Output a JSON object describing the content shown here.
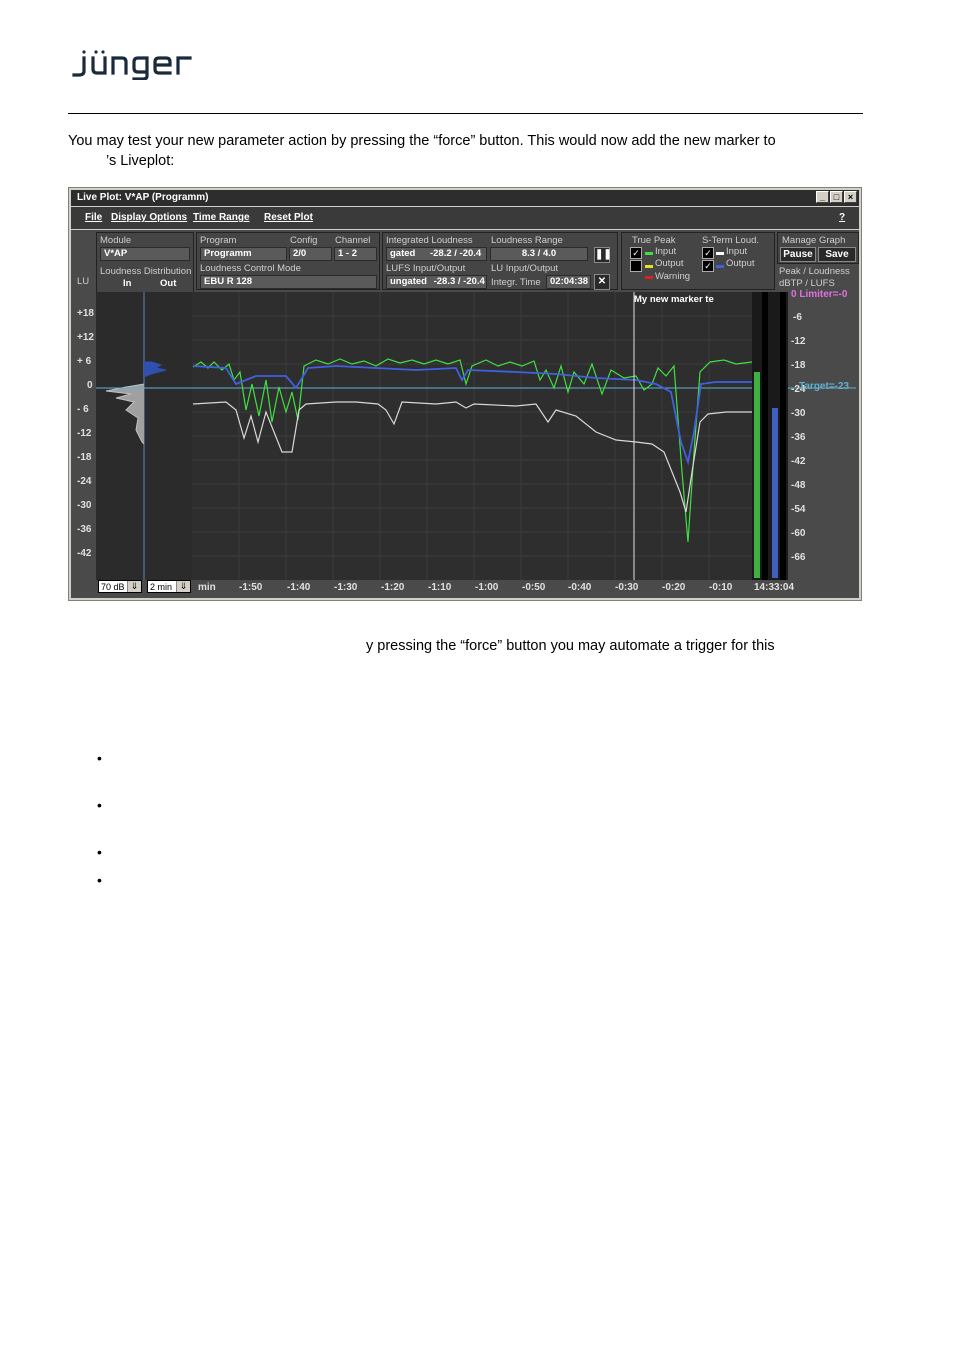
{
  "header": {
    "logo_text": "jünger"
  },
  "intro_text": "You may test your new parameter action by pressing the “force” button. This would now add the new marker to",
  "intro_text_2": "’s Liveplot:",
  "window": {
    "title": "Live Plot: V*AP   (Programm)",
    "menu": [
      "File",
      "Display Options",
      "Time Range",
      "Reset Plot"
    ],
    "help": "?",
    "module": {
      "label": "Module",
      "value": "V*AP"
    },
    "loudness_distribution": {
      "label": "Loudness Distribution",
      "in": "In",
      "out": "Out"
    },
    "program": {
      "label": "Program",
      "value": "Programm"
    },
    "config": {
      "label": "Config",
      "value": "2/0"
    },
    "channel": {
      "label": "Channel",
      "value": "1 - 2"
    },
    "control_mode": {
      "label": "Loudness Control Mode",
      "value": "EBU R 128"
    },
    "integrated": {
      "label": "Integrated Loudness",
      "mode": "gated",
      "value": "-28.2 / -20.4"
    },
    "range": {
      "label": "Loudness Range",
      "value": "8.3 / 4.0"
    },
    "lufs_io": {
      "label": "LUFS Input/Output",
      "mode": "ungated",
      "value": "-28.3 / -20.4"
    },
    "lu_io": {
      "label": "LU Input/Output",
      "time_label": "Integr. Time",
      "time": "02:04:38"
    },
    "pause_icon": "pause-icon",
    "reset_icon": "close-icon",
    "true_peak": {
      "label": "True Peak",
      "input": "Input",
      "output": "Output",
      "warning": "Warning"
    },
    "short_term": {
      "label": "S-Term Loud.",
      "input": "Input",
      "output": "Output"
    },
    "manage_graph": {
      "label": "Manage Graph",
      "pause": "Pause",
      "save": "Save"
    },
    "peak_loudness": {
      "label": "Peak / Loudness",
      "unit": "dBTP / LUFS"
    },
    "lu_axis_label": "LU",
    "lu_ticks": [
      "+18",
      "+12",
      "+ 6",
      "0",
      "- 6",
      "-12",
      "-18",
      "-24",
      "-30",
      "-36",
      "-42"
    ],
    "right_ticks": [
      "-6",
      "-12",
      "-18",
      "-24",
      "-30",
      "-36",
      "-42",
      "-48",
      "-54",
      "-60",
      "-66"
    ],
    "limiter": "0 Limiter=-0",
    "target": "Target=-23",
    "marker": "My new marker te",
    "x_unit": "min",
    "x_ticks": [
      "-1:50",
      "-1:40",
      "-1:30",
      "-1:20",
      "-1:10",
      "-1:00",
      "-0:50",
      "-0:40",
      "-0:30",
      "-0:20",
      "-0:10"
    ],
    "clock": "14:33:04",
    "range_select": "70 dB",
    "time_select": "2 min",
    "colors": {
      "input_tp": "#40e040",
      "output_tp": "#e0e020",
      "warning": "#e02020",
      "st_input": "#ffffff",
      "st_output": "#4060e0",
      "limiter": "#e070e0",
      "target": "#60b0d0"
    }
  },
  "body_text": "y pressing the “force” button you may automate a trigger for this",
  "bullets": [
    "•",
    "•",
    "•",
    "•"
  ]
}
